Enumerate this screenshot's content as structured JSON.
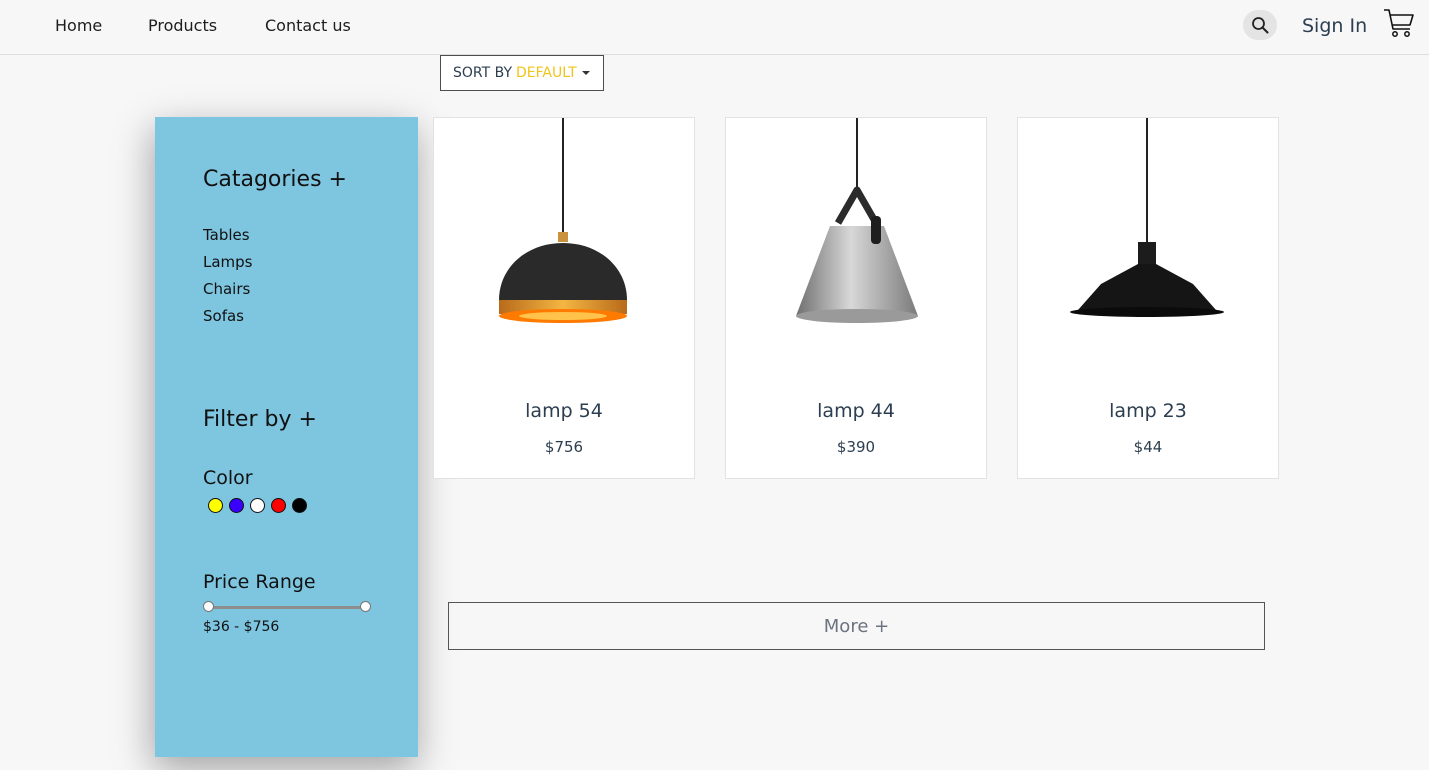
{
  "nav": {
    "links": [
      "Home",
      "Products",
      "Contact us"
    ],
    "sign_in": "Sign In"
  },
  "sort": {
    "label": "SORT BY",
    "value": "DEFAULT"
  },
  "sidebar": {
    "categories_heading": "Catagories +",
    "categories": [
      "Tables",
      "Lamps",
      "Chairs",
      "Sofas"
    ],
    "filter_heading": "Filter by +",
    "color_label": "Color",
    "colors": [
      "#ffff00",
      "#3a00ff",
      "#ffffff",
      "#ff0000",
      "#000000"
    ],
    "price_label": "Price Range",
    "price_range_text": "$36 - $756",
    "price_min": 36,
    "price_max": 756
  },
  "products": [
    {
      "name": "lamp 54",
      "price": "$756"
    },
    {
      "name": "lamp 44",
      "price": "$390"
    },
    {
      "name": "lamp 23",
      "price": "$44"
    }
  ],
  "more_button": "More +",
  "colors": {
    "sidebar_bg": "#7ec5e0",
    "sort_accent": "#f0c419",
    "text_dark": "#2c3e50"
  }
}
